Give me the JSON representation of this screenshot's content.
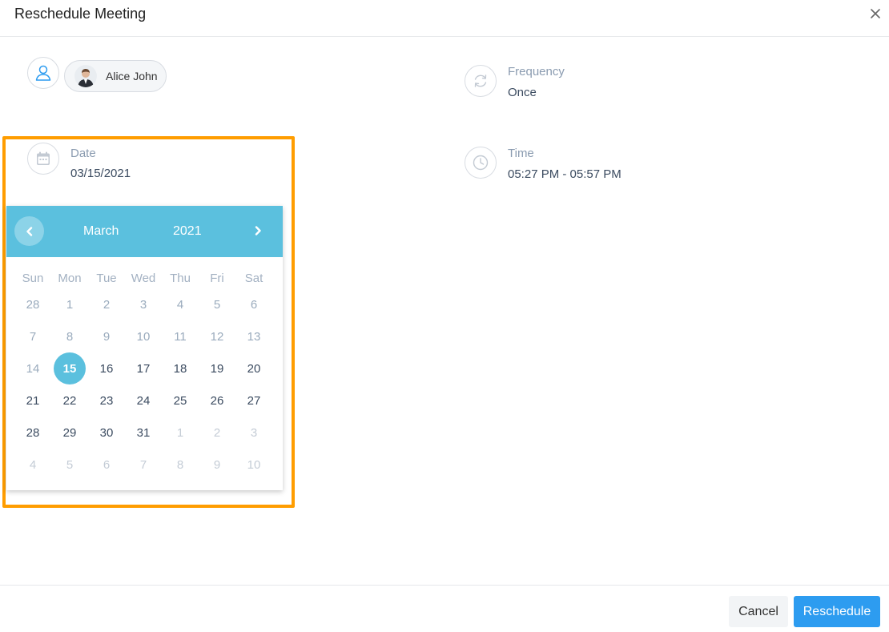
{
  "dialog": {
    "title": "Reschedule Meeting"
  },
  "attendees": {
    "items": [
      {
        "name": "Alice John"
      }
    ]
  },
  "frequency": {
    "label": "Frequency",
    "value": "Once"
  },
  "date": {
    "label": "Date",
    "value": "03/15/2021"
  },
  "time": {
    "label": "Time",
    "value": "05:27 PM - 05:57 PM"
  },
  "calendar": {
    "month": "March",
    "year": "2021",
    "weekdays": [
      "Sun",
      "Mon",
      "Tue",
      "Wed",
      "Thu",
      "Fri",
      "Sat"
    ],
    "days": [
      {
        "n": "28",
        "state": "past"
      },
      {
        "n": "1",
        "state": "past"
      },
      {
        "n": "2",
        "state": "past"
      },
      {
        "n": "3",
        "state": "past"
      },
      {
        "n": "4",
        "state": "past"
      },
      {
        "n": "5",
        "state": "past"
      },
      {
        "n": "6",
        "state": "past"
      },
      {
        "n": "7",
        "state": "past"
      },
      {
        "n": "8",
        "state": "past"
      },
      {
        "n": "9",
        "state": "past"
      },
      {
        "n": "10",
        "state": "past"
      },
      {
        "n": "11",
        "state": "past"
      },
      {
        "n": "12",
        "state": "past"
      },
      {
        "n": "13",
        "state": "past"
      },
      {
        "n": "14",
        "state": "past"
      },
      {
        "n": "15",
        "state": "selected"
      },
      {
        "n": "16",
        "state": "future"
      },
      {
        "n": "17",
        "state": "future"
      },
      {
        "n": "18",
        "state": "future"
      },
      {
        "n": "19",
        "state": "future"
      },
      {
        "n": "20",
        "state": "future"
      },
      {
        "n": "21",
        "state": "future"
      },
      {
        "n": "22",
        "state": "future"
      },
      {
        "n": "23",
        "state": "future"
      },
      {
        "n": "24",
        "state": "future"
      },
      {
        "n": "25",
        "state": "future"
      },
      {
        "n": "26",
        "state": "future"
      },
      {
        "n": "27",
        "state": "future"
      },
      {
        "n": "28",
        "state": "future"
      },
      {
        "n": "29",
        "state": "future"
      },
      {
        "n": "30",
        "state": "future"
      },
      {
        "n": "31",
        "state": "future"
      },
      {
        "n": "1",
        "state": "other"
      },
      {
        "n": "2",
        "state": "other"
      },
      {
        "n": "3",
        "state": "other"
      },
      {
        "n": "4",
        "state": "other"
      },
      {
        "n": "5",
        "state": "other"
      },
      {
        "n": "6",
        "state": "other"
      },
      {
        "n": "7",
        "state": "other"
      },
      {
        "n": "8",
        "state": "other"
      },
      {
        "n": "9",
        "state": "other"
      },
      {
        "n": "10",
        "state": "other"
      }
    ]
  },
  "footer": {
    "cancel_label": "Cancel",
    "submit_label": "Reschedule"
  },
  "icons": {
    "close": "close-icon",
    "user": "user-icon",
    "frequency": "refresh-icon",
    "date": "calendar-icon",
    "time": "clock-icon",
    "prev": "chevron-left-icon",
    "next": "chevron-right-icon"
  },
  "colors": {
    "accent": "#5bc0de",
    "primary_button": "#2d9cf0",
    "highlight": "#ff9d00"
  }
}
